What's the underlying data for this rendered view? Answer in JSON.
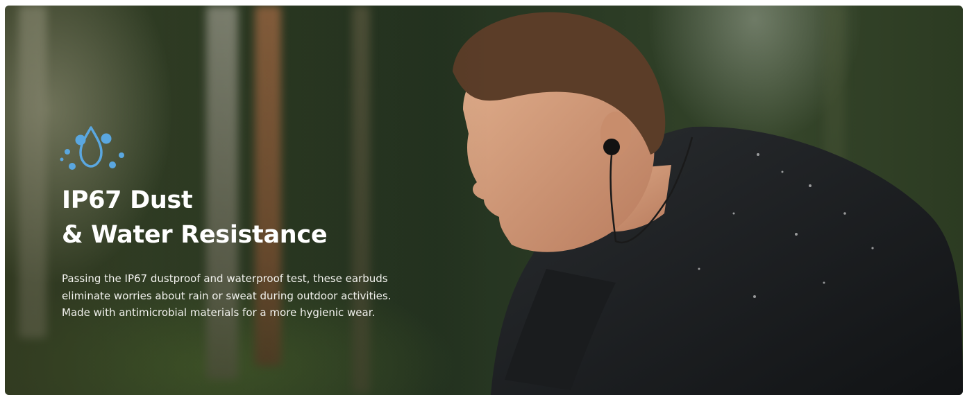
{
  "banner": {
    "icon": "water-drop-icon",
    "title_line1": "IP67 Dust",
    "title_line2": "& Water Resistance",
    "description": "Passing the IP67 dustproof and waterproof test, these earbuds eliminate worries about rain or sweat during outdoor activities. Made with antimicrobial materials for a more hygienic wear."
  },
  "colors": {
    "accent": "#5aa7e0",
    "text": "#ffffff"
  }
}
